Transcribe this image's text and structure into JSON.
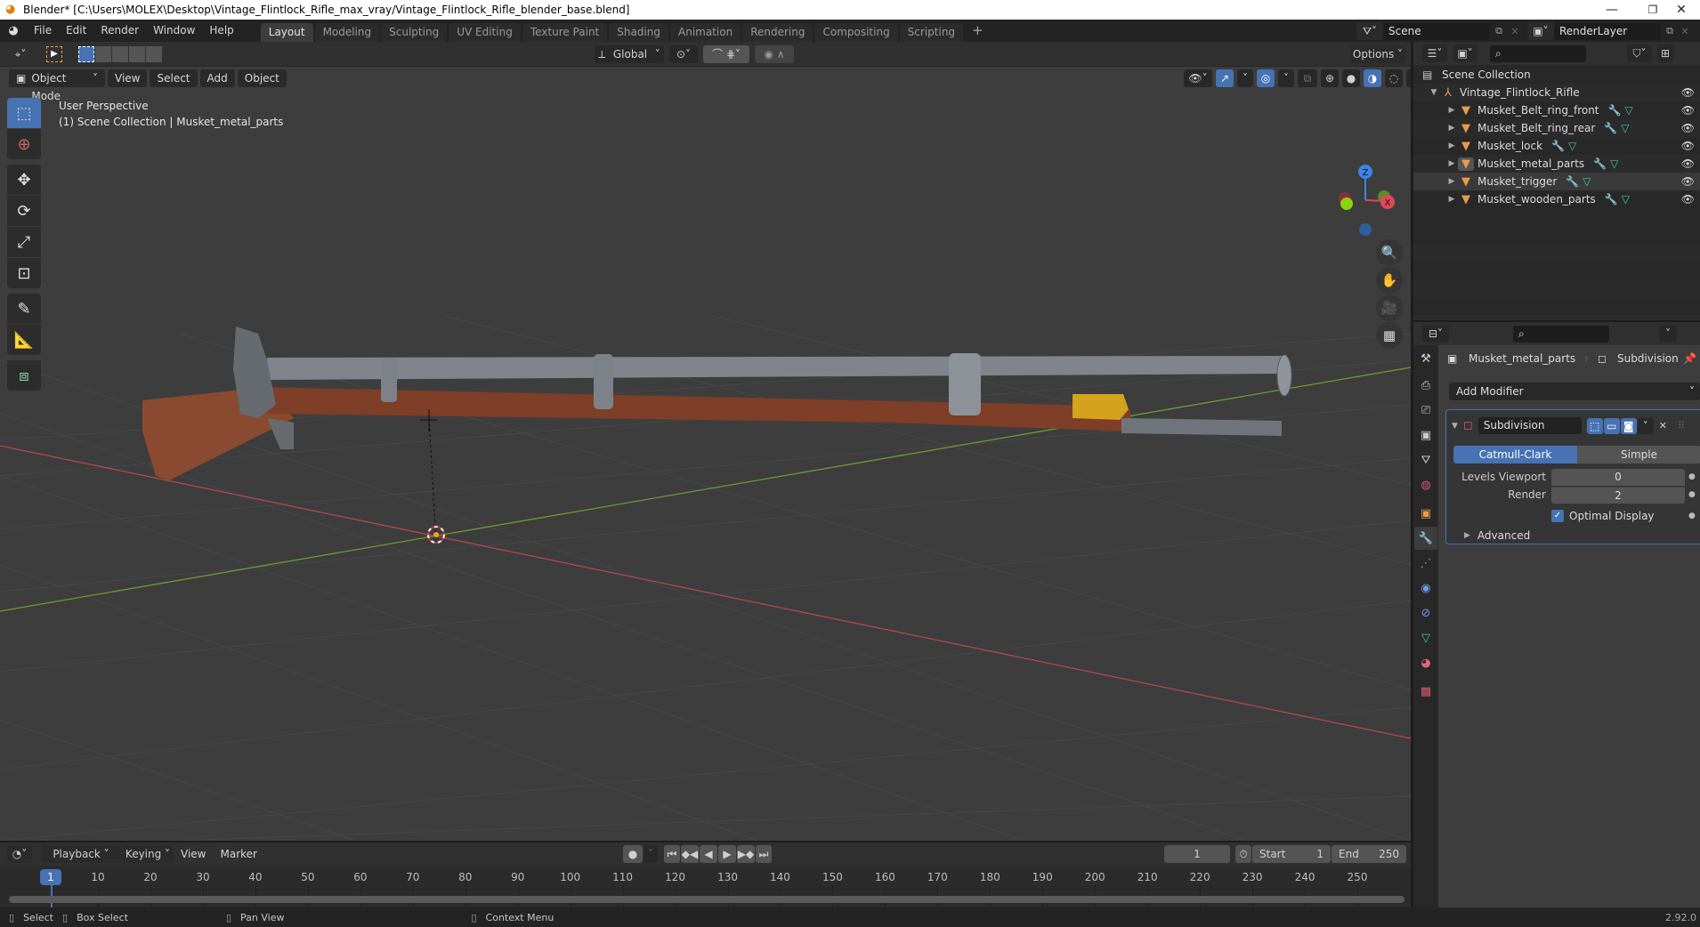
{
  "window": {
    "title": "Blender* [C:\\Users\\MOLEX\\Desktop\\Vintage_Flintlock_Rifle_max_vray/Vintage_Flintlock_Rifle_blender_base.blend]",
    "minimize": "—",
    "maximize": "❐",
    "close": "✕"
  },
  "topbar": {
    "menus": [
      "File",
      "Edit",
      "Render",
      "Window",
      "Help"
    ],
    "workspaces": [
      "Layout",
      "Modeling",
      "Sculpting",
      "UV Editing",
      "Texture Paint",
      "Shading",
      "Animation",
      "Rendering",
      "Compositing",
      "Scripting"
    ],
    "active_workspace": "Layout",
    "add_workspace": "+",
    "scene_label": "Scene",
    "renderlayer_label": "RenderLayer"
  },
  "toolheader": {
    "transform_orientation": "Global",
    "options_label": "Options"
  },
  "viewport": {
    "mode": "Object Mode",
    "menus": [
      "View",
      "Select",
      "Add",
      "Object"
    ],
    "overlay_title": "User Perspective",
    "overlay_subtitle": "(1) Scene Collection | Musket_metal_parts",
    "gizmo": {
      "z": "Z",
      "x": "X",
      "y": "Y"
    },
    "colors": {
      "bg": "#3d3d3d",
      "x_axis": "#b5474f",
      "y_axis": "#6e9a34",
      "wood": "#8a4a30",
      "metal": "#7f858a",
      "brass": "#d4a21c"
    }
  },
  "outliner": {
    "root": "Scene Collection",
    "collection": "Vintage_Flintlock_Rifle",
    "objects": [
      {
        "name": "Musket_Belt_ring_front",
        "selected": false
      },
      {
        "name": "Musket_Belt_ring_rear",
        "selected": false
      },
      {
        "name": "Musket_lock",
        "selected": false
      },
      {
        "name": "Musket_metal_parts",
        "selected": false,
        "active": true
      },
      {
        "name": "Musket_trigger",
        "selected": true
      },
      {
        "name": "Musket_wooden_parts",
        "selected": false
      }
    ]
  },
  "properties": {
    "breadcrumb_object": "Musket_metal_parts",
    "breadcrumb_modifier": "Subdivision",
    "add_modifier": "Add Modifier",
    "modifier": {
      "name": "Subdivision",
      "type_options": [
        "Catmull-Clark",
        "Simple"
      ],
      "type_selected": "Catmull-Clark",
      "levels_viewport_label": "Levels Viewport",
      "levels_viewport": "0",
      "render_label": "Render",
      "render": "2",
      "optimal_display_label": "Optimal Display",
      "optimal_display": true,
      "advanced_label": "Advanced"
    }
  },
  "timeline": {
    "menus": [
      "Playback",
      "Keying",
      "View",
      "Marker"
    ],
    "current_frame": "1",
    "start_label": "Start",
    "start": "1",
    "end_label": "End",
    "end": "250",
    "ticks": [
      "1",
      "10",
      "20",
      "30",
      "40",
      "50",
      "60",
      "70",
      "80",
      "90",
      "100",
      "110",
      "120",
      "130",
      "140",
      "150",
      "160",
      "170",
      "180",
      "190",
      "200",
      "210",
      "220",
      "230",
      "240",
      "250"
    ]
  },
  "statusbar": {
    "select": "Select",
    "box_select": "Box Select",
    "pan_view": "Pan View",
    "context_menu": "Context Menu",
    "version": "2.92.0"
  }
}
